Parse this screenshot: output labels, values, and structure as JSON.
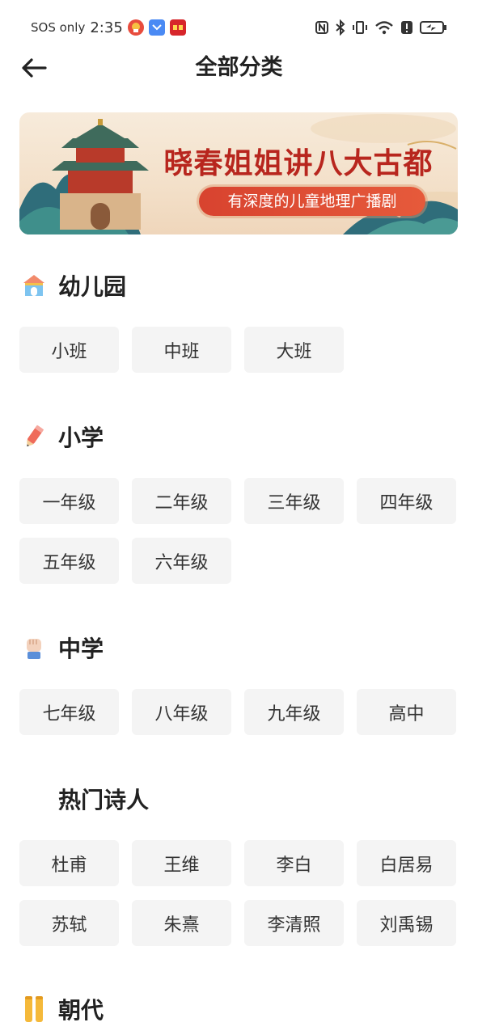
{
  "status_bar": {
    "carrier": "SOS only",
    "time": "2:35"
  },
  "header": {
    "title": "全部分类"
  },
  "banner": {
    "title": "晓春姐姐讲八大古都",
    "subtitle": "有深度的儿童地理广播剧"
  },
  "sections": [
    {
      "title": "幼儿园",
      "icon": "kindergarten-icon",
      "items": [
        "小班",
        "中班",
        "大班"
      ]
    },
    {
      "title": "小学",
      "icon": "pencil-icon",
      "items": [
        "一年级",
        "二年级",
        "三年级",
        "四年级",
        "五年级",
        "六年级"
      ]
    },
    {
      "title": "中学",
      "icon": "fist-icon",
      "items": [
        "七年级",
        "八年级",
        "九年级",
        "高中"
      ]
    },
    {
      "title": "热门诗人",
      "icon": "",
      "items": [
        "杜甫",
        "王维",
        "李白",
        "白居易",
        "苏轼",
        "朱熹",
        "李清照",
        "刘禹锡"
      ]
    },
    {
      "title": "朝代",
      "icon": "scroll-icon",
      "items": []
    }
  ],
  "colors": {
    "accent_red": "#b8261e",
    "chip_bg": "#f4f4f4",
    "text": "#222222"
  }
}
